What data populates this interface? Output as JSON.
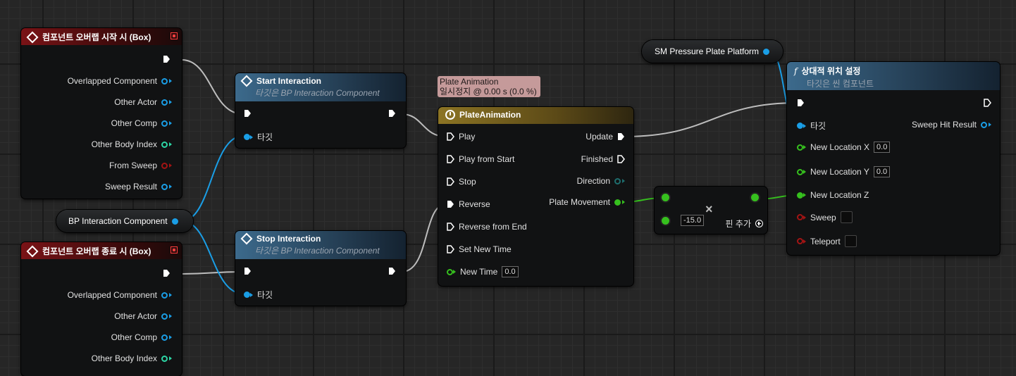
{
  "events": {
    "begin_overlap": {
      "title": "컴포넌트 오버랩 시작 시 (Box)",
      "pins": [
        "Overlapped Component",
        "Other Actor",
        "Other Comp",
        "Other Body Index",
        "From Sweep",
        "Sweep Result"
      ]
    },
    "end_overlap": {
      "title": "컴포넌트 오버랩 종료 시 (Box)",
      "pins": [
        "Overlapped Component",
        "Other Actor",
        "Other Comp",
        "Other Body Index"
      ]
    }
  },
  "bp_interaction_var": {
    "label": "BP Interaction Component"
  },
  "start_interaction": {
    "title": "Start Interaction",
    "subtitle": "타깃은 BP Interaction Component",
    "target_label": "타깃"
  },
  "stop_interaction": {
    "title": "Stop Interaction",
    "subtitle": "타깃은 BP Interaction Component",
    "target_label": "타깃"
  },
  "timeline": {
    "tooltip_line1": "Plate Animation",
    "tooltip_line2": "일시정지 @ 0.00 s (0.0 %)",
    "title": "PlateAnimation",
    "inputs": [
      "Play",
      "Play from Start",
      "Stop",
      "Reverse",
      "Reverse from End",
      "Set New Time",
      "New Time"
    ],
    "new_time_value": "0.0",
    "outputs": [
      "Update",
      "Finished",
      "Direction",
      "Plate Movement"
    ]
  },
  "multiply_node": {
    "value": "-15.0",
    "add_pin_label": "핀 추가"
  },
  "sm_platform_var": {
    "label": "SM Pressure Plate Platform"
  },
  "set_location": {
    "title": "상대적 위치 설정",
    "subtitle": "타깃은 씬 컴포넌트",
    "target_label": "타깃",
    "sweep_hit_result": "Sweep Hit Result",
    "new_location_x": "New Location X",
    "new_location_x_value": "0.0",
    "new_location_y": "New Location Y",
    "new_location_y_value": "0.0",
    "new_location_z": "New Location Z",
    "sweep": "Sweep",
    "teleport": "Teleport"
  },
  "colors": {
    "exec": "#ffffff",
    "object_pin": "#1a9ee6",
    "float_pin": "#36c01e",
    "int_pin": "#2dd7a6",
    "bool_pin": "#a31414",
    "event_header": "#7a1316",
    "function_header": "#3c6a8c",
    "timeline_header": "#8c7424"
  },
  "icons": {
    "event": "event-diamond-icon",
    "function": "function-f-icon",
    "timeline": "clock-icon",
    "close": "close-x-icon",
    "add": "plus-circle-icon"
  }
}
